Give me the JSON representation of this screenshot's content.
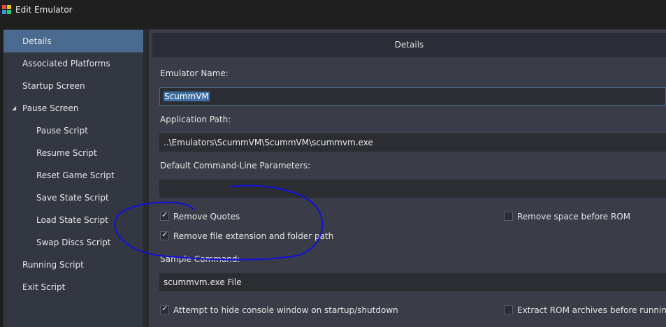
{
  "window": {
    "title": "Edit Emulator"
  },
  "sidebar": {
    "items": [
      {
        "label": "Details",
        "selected": true,
        "indent": 1
      },
      {
        "label": "Associated Platforms",
        "indent": 1
      },
      {
        "label": "Startup Screen",
        "indent": 1
      },
      {
        "label": "Pause Screen",
        "indent": 1,
        "expanded": true
      },
      {
        "label": "Pause Script",
        "indent": 2
      },
      {
        "label": "Resume Script",
        "indent": 2
      },
      {
        "label": "Reset Game Script",
        "indent": 2
      },
      {
        "label": "Save State Script",
        "indent": 2
      },
      {
        "label": "Load State Script",
        "indent": 2
      },
      {
        "label": "Swap Discs Script",
        "indent": 2
      },
      {
        "label": "Running Script",
        "indent": 1
      },
      {
        "label": "Exit Script",
        "indent": 1
      }
    ],
    "expand_glyph": "◢"
  },
  "details": {
    "header": "Details",
    "emulator_name_label": "Emulator Name:",
    "emulator_name_value": "ScummVM",
    "application_path_label": "Application Path:",
    "application_path_value": "..\\Emulators\\ScummVM\\ScummVM\\scummvm.exe",
    "command_line_label": "Default Command-Line Parameters:",
    "command_line_value": "",
    "remove_quotes_label": "Remove Quotes",
    "remove_quotes_checked": true,
    "remove_space_label": "Remove space before ROM",
    "remove_space_checked": false,
    "remove_extension_label": "Remove file extension and folder path",
    "remove_extension_checked": true,
    "sample_command_label": "Sample Command:",
    "sample_command_value": "scummvm.exe File",
    "hide_console_label": "Attempt to hide console window on startup/shutdown",
    "hide_console_checked": true,
    "extract_rom_label": "Extract ROM archives before running",
    "extract_rom_checked": false,
    "check_glyph": "✓"
  },
  "colors": {
    "selection": "#4a6b8f",
    "annotation": "#1010e0"
  }
}
